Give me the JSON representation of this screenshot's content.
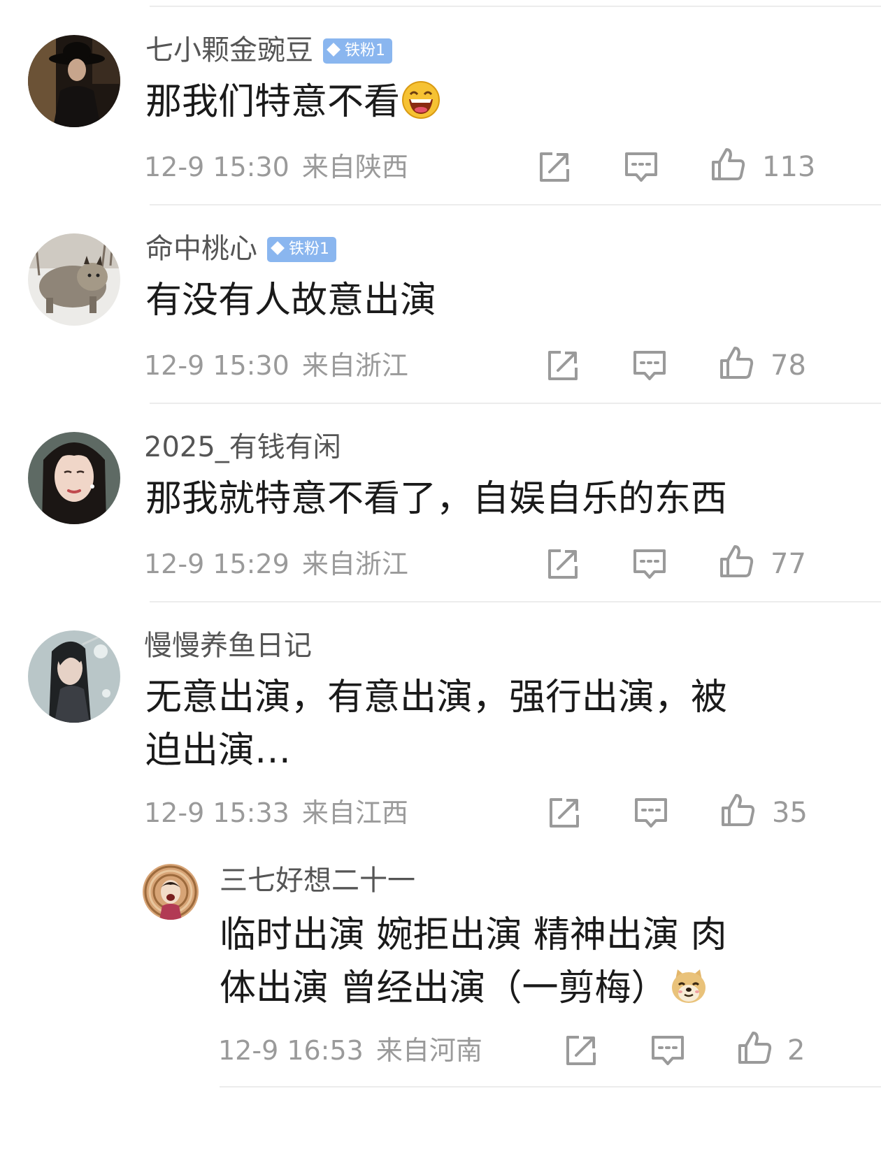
{
  "comments": [
    {
      "username": "七小颗金豌豆",
      "badge": "铁粉1",
      "text": "那我们特意不看",
      "time": "12-9 15:30",
      "location": "来自陕西",
      "likes": "113"
    },
    {
      "username": "命中桃心",
      "badge": "铁粉1",
      "text": "有没有人故意出演",
      "time": "12-9 15:30",
      "location": "来自浙江",
      "likes": "78"
    },
    {
      "username": "2025_有钱有闲",
      "text": "那我就特意不看了，自娱自乐的东西",
      "time": "12-9 15:29",
      "location": "来自浙江",
      "likes": "77"
    },
    {
      "username": "慢慢养鱼日记",
      "text_line1": "无意出演，有意出演，强行出演，被",
      "text_line2": "迫出演…",
      "time": "12-9 15:33",
      "location": "来自江西",
      "likes": "35"
    }
  ],
  "reply": {
    "username": "三七好想二十一",
    "text_line1": "临时出演 婉拒出演 精神出演  肉",
    "text_line2": "体出演 曾经出演（一剪梅）",
    "time": "12-9 16:53",
    "location": "来自河南",
    "likes": "2"
  },
  "icons": {
    "share": "share-icon",
    "comment": "comment-icon",
    "like": "thumbs-up-icon",
    "emoji_laugh": "laughing-face-emoji",
    "emoji_doge": "doge-emoji"
  },
  "colors": {
    "text": "#1a1a1a",
    "username": "#555555",
    "meta": "#9a9a9a",
    "badge": "#8ab6ef",
    "divider": "#ececec"
  }
}
